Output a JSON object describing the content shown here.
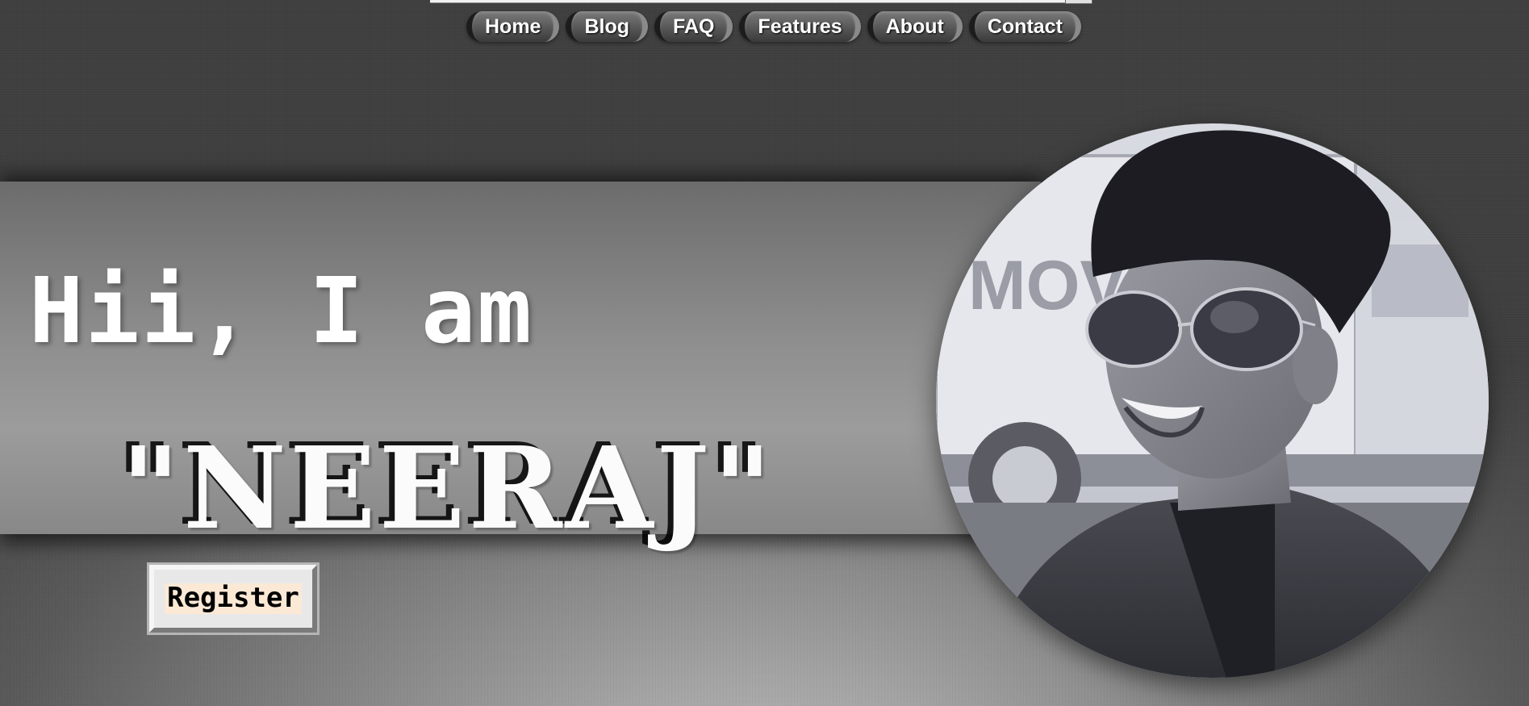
{
  "nav": {
    "items": [
      {
        "label": "Home"
      },
      {
        "label": "Blog"
      },
      {
        "label": "FAQ"
      },
      {
        "label": "Features"
      },
      {
        "label": "About"
      },
      {
        "label": "Contact"
      }
    ]
  },
  "hero": {
    "greeting": "Hii, I am",
    "name": "\"NEERAJ\"",
    "register_label": "Register"
  },
  "portrait": {
    "truck_text": "MOVE"
  }
}
